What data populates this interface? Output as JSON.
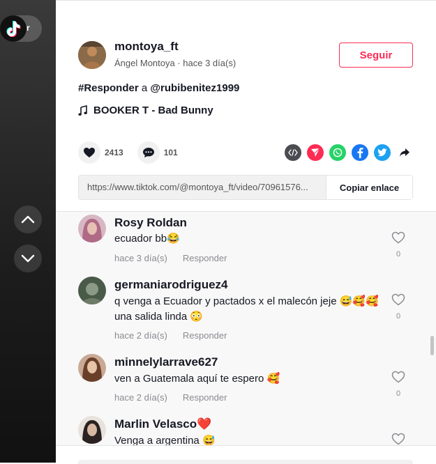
{
  "sidebar": {
    "pill_text": "r"
  },
  "post": {
    "username": "montoya_ft",
    "display_name": "Ángel Montoya",
    "time_ago": "hace 3 días",
    "subline": "Ángel Montoya · hace 3 día(s)",
    "follow_label": "Seguir",
    "reply_prefix": "#Responder",
    "reply_word": "a",
    "reply_target": "@rubibenitez1999",
    "music": "BOOKER T - Bad Bunny",
    "likes": "2413",
    "comments_count": "101",
    "link_url": "https://www.tiktok.com/@montoya_ft/video/70961576...",
    "copy_label": "Copiar enlace"
  },
  "colors": {
    "accent": "#fe2c55",
    "embed": "#4b4b52",
    "send": "#fe2c55",
    "whatsapp": "#25d366",
    "facebook": "#1877f2",
    "twitter": "#1da1f2"
  },
  "comments": [
    {
      "name": "Rosy Roldan",
      "text": "ecuador bb😂",
      "time": "hace 3 día(s)",
      "reply": "Responder",
      "likes": "0"
    },
    {
      "name": "germaniarodriguez4",
      "text": "q venga a Ecuador y pactados x el malecón jeje 😅🥰🥰 una salida linda 😳",
      "time": "hace 2 día(s)",
      "reply": "Responder",
      "likes": "0"
    },
    {
      "name": "minnelylarrave627",
      "text": "ven a Guatemala aquí te espero 🥰",
      "time": "hace 2 día(s)",
      "reply": "Responder",
      "likes": "0"
    },
    {
      "name": "Marlin Velasco❤️",
      "text": "Venga a argentina 😅",
      "time": "",
      "reply": "",
      "likes": ""
    }
  ]
}
